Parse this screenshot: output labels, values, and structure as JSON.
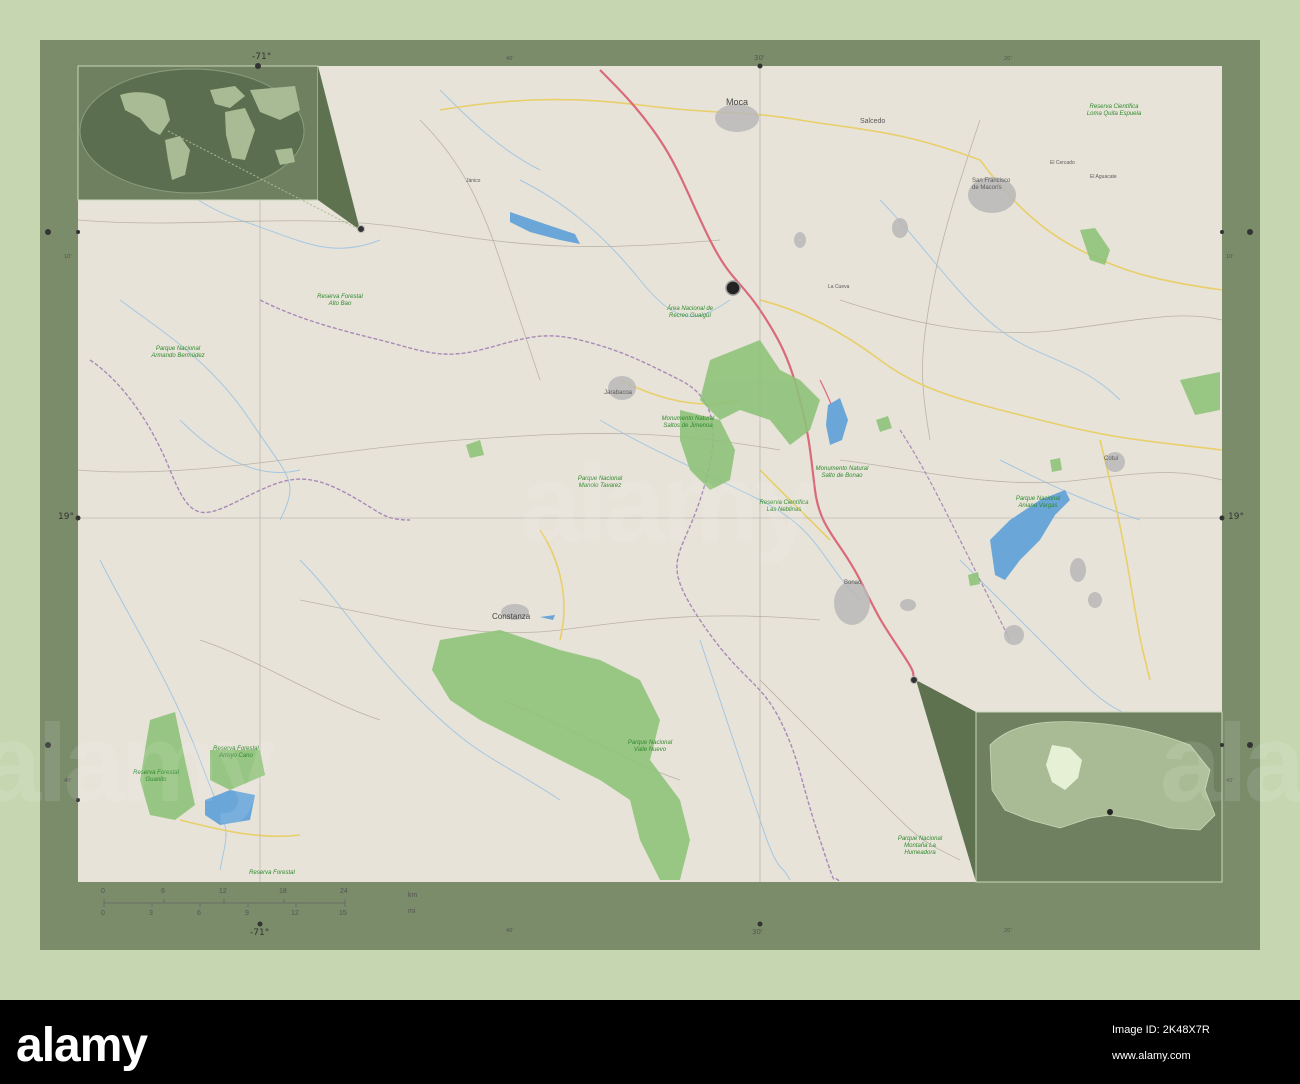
{
  "map": {
    "coord_labels": {
      "lon_left_top": "-71°",
      "lon_left_bottom": "-71°",
      "lon_mid_top": "30'",
      "lon_mid_bottom": "30'",
      "lat_left": "19°",
      "lat_right": "19°",
      "minor_40_top": "40'",
      "minor_40_bottom": "40'",
      "minor_20_top": "20'",
      "minor_20_bottom": "20'",
      "minor_10_top": "10'",
      "minor_10_left": "10'",
      "minor_10_right": "10'",
      "minor_40_left": "40'",
      "minor_40_right": "40'"
    },
    "scale_bar": {
      "km_ticks": [
        "0",
        "6",
        "12",
        "18",
        "24"
      ],
      "mi_ticks": [
        "0",
        "3",
        "6",
        "9",
        "12",
        "15"
      ],
      "km_unit": "km",
      "mi_unit": "mi"
    },
    "cities": [
      {
        "id": "moca",
        "name": "Moca"
      },
      {
        "id": "salcedo",
        "name": "Salcedo"
      },
      {
        "id": "san-francisco",
        "name": "San Francisco de Macorís"
      },
      {
        "id": "jarabacoa",
        "name": "Jarabacoa"
      },
      {
        "id": "constanza",
        "name": "Constanza"
      },
      {
        "id": "bonao",
        "name": "Bonao"
      },
      {
        "id": "cotui",
        "name": "Cotuí"
      },
      {
        "id": "la-cueva",
        "name": "La Cueva"
      },
      {
        "id": "janico",
        "name": "Jánico"
      },
      {
        "id": "el-cercado",
        "name": "El Cercado"
      },
      {
        "id": "el-aguacate",
        "name": "El Aguacate"
      }
    ],
    "parks": [
      {
        "id": "loma-quita-espuela",
        "name": "Reserva Científica Loma Quita Espuela"
      },
      {
        "id": "alto-bao",
        "name": "Reserva Forestal Alto Bao"
      },
      {
        "id": "armando-bermudez",
        "name": "Parque Nacional Armando Bermúdez"
      },
      {
        "id": "saltos-jimenoa",
        "name": "Monumento Natural Saltos de Jimenoa"
      },
      {
        "id": "area-humeda",
        "name": "Área Nacional de Recreo Guaigüí"
      },
      {
        "id": "manolo-tavarez",
        "name": "Parque Nacional Manolo Tavarez"
      },
      {
        "id": "saltos-bonao",
        "name": "Monumento Natural Salto de Bonao"
      },
      {
        "id": "las-neblinas",
        "name": "Reserva Científica Las Neblinas"
      },
      {
        "id": "aniana-vargas",
        "name": "Parque Nacional Aniana Vargas"
      },
      {
        "id": "guanito",
        "name": "Reserva Forestal Guanito"
      },
      {
        "id": "arroyo-cano",
        "name": "Reserva Forestal Arroyo Cano"
      },
      {
        "id": "montana-humeadora",
        "name": "Parque Nacional Montaña La Humeadora"
      },
      {
        "id": "valle-nuevo",
        "name": "Parque Nacional Valle Nuevo"
      },
      {
        "id": "reserva-forestal",
        "name": "Reserva Forestal"
      }
    ],
    "colors": {
      "land": "#ebe6dc",
      "park": "#8fc27a",
      "water": "#6aa6d8",
      "highway": "#d96a7a",
      "frame": "#7a8c6a",
      "inset_bg": "#6e8060"
    }
  },
  "footer": {
    "logo": "alamy",
    "image_id": "Image ID: 2K48X7R",
    "site": "www.alamy.com"
  },
  "watermark": "alamy"
}
